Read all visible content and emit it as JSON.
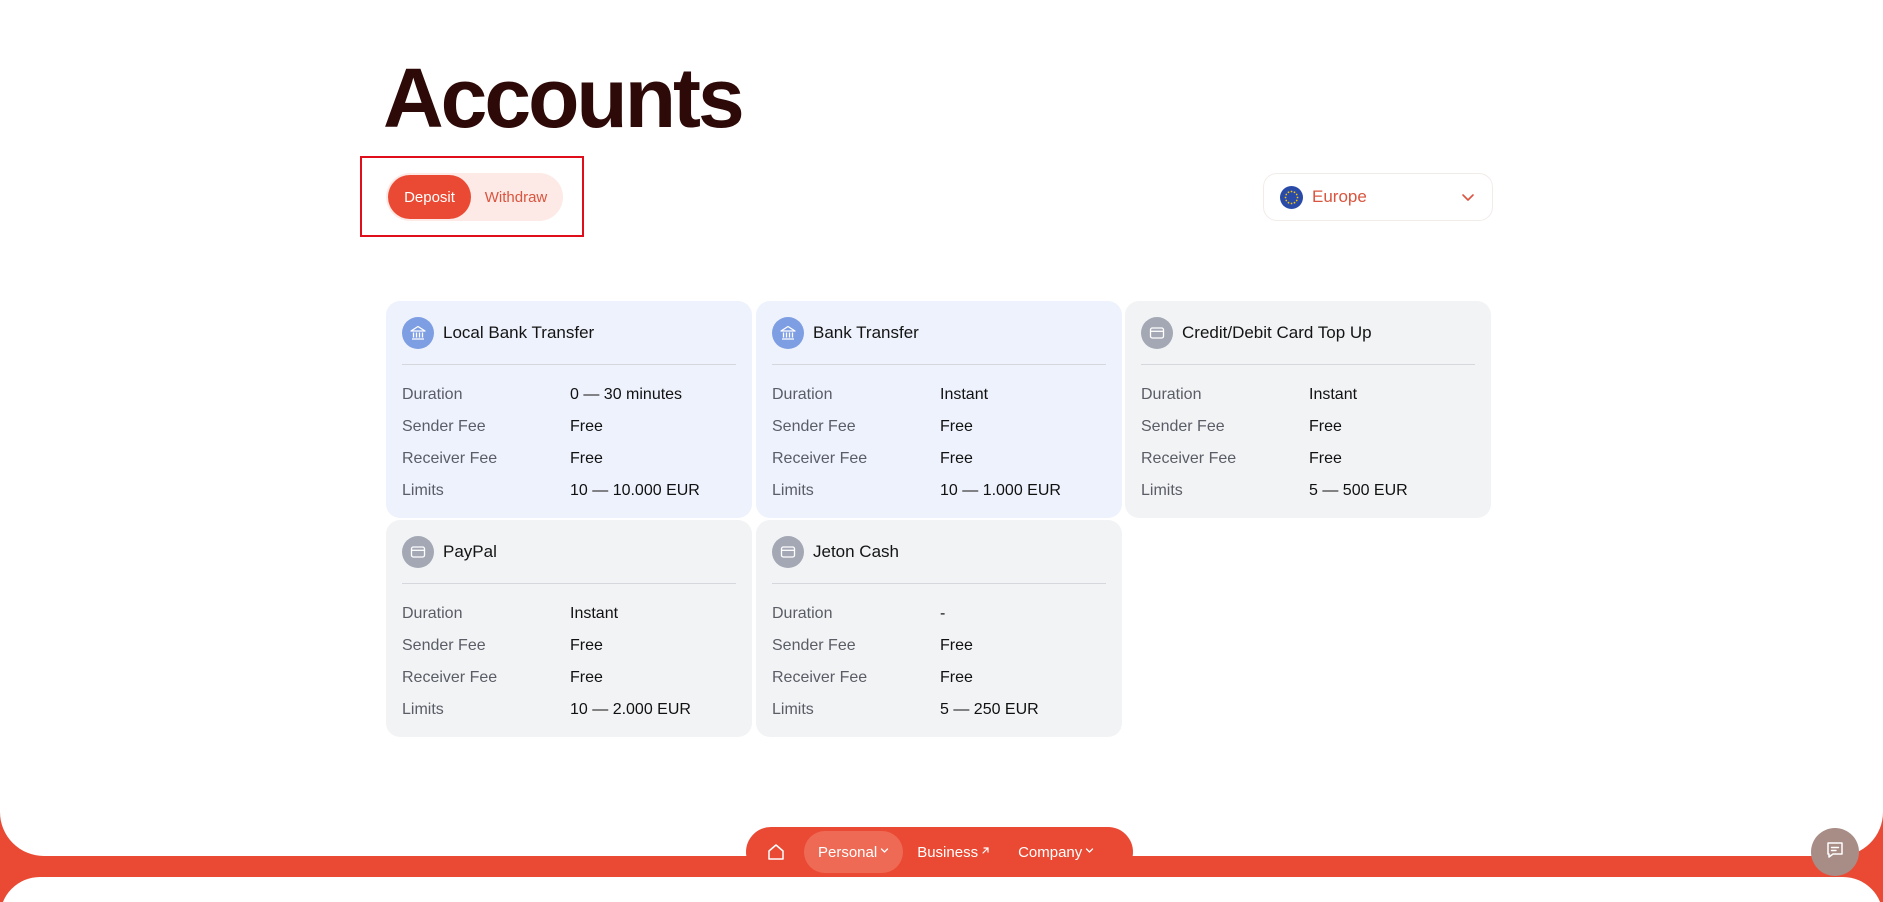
{
  "page": {
    "title": "Accounts"
  },
  "toggle": {
    "deposit_label": "Deposit",
    "withdraw_label": "Withdraw",
    "selected": "Deposit"
  },
  "region": {
    "label": "Europe",
    "icon": "eu-flag-icon"
  },
  "methods": [
    {
      "title": "Local Bank Transfer",
      "icon": "bank-icon",
      "rows": [
        {
          "label": "Duration",
          "value": "0 — 30 minutes"
        },
        {
          "label": "Sender Fee",
          "value": "Free"
        },
        {
          "label": "Receiver Fee",
          "value": "Free"
        },
        {
          "label": "Limits",
          "value": "10 — 10.000 EUR"
        }
      ]
    },
    {
      "title": "Bank Transfer",
      "icon": "bank-icon",
      "rows": [
        {
          "label": "Duration",
          "value": "Instant"
        },
        {
          "label": "Sender Fee",
          "value": "Free"
        },
        {
          "label": "Receiver Fee",
          "value": "Free"
        },
        {
          "label": "Limits",
          "value": "10 — 1.000 EUR"
        }
      ]
    },
    {
      "title": "Credit/Debit Card Top Up",
      "icon": "card-icon",
      "rows": [
        {
          "label": "Duration",
          "value": "Instant"
        },
        {
          "label": "Sender Fee",
          "value": "Free"
        },
        {
          "label": "Receiver Fee",
          "value": "Free"
        },
        {
          "label": "Limits",
          "value": "5 — 500 EUR"
        }
      ]
    },
    {
      "title": "PayPal",
      "icon": "card-icon",
      "rows": [
        {
          "label": "Duration",
          "value": "Instant"
        },
        {
          "label": "Sender Fee",
          "value": "Free"
        },
        {
          "label": "Receiver Fee",
          "value": "Free"
        },
        {
          "label": "Limits",
          "value": "10 — 2.000 EUR"
        }
      ]
    },
    {
      "title": "Jeton Cash",
      "icon": "card-icon",
      "rows": [
        {
          "label": "Duration",
          "value": "-"
        },
        {
          "label": "Sender Fee",
          "value": "Free"
        },
        {
          "label": "Receiver Fee",
          "value": "Free"
        },
        {
          "label": "Limits",
          "value": "5 — 250 EUR"
        }
      ]
    }
  ],
  "nav": {
    "home_icon": "home-icon",
    "personal": "Personal",
    "business": "Business",
    "company": "Company"
  },
  "chat": {
    "icon": "chat-icon"
  },
  "colors": {
    "accent": "#ea4a33",
    "title": "#2d0a08",
    "card_blue": "#eef2fc",
    "card_grey": "#f2f3f5"
  }
}
